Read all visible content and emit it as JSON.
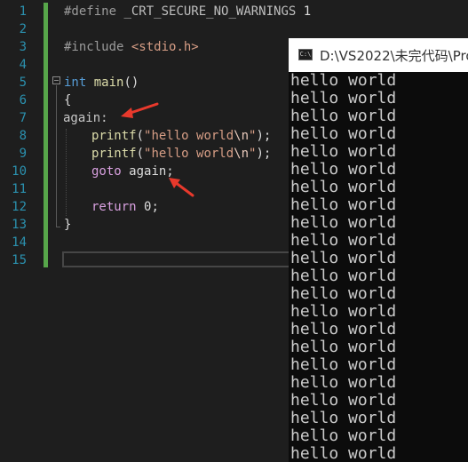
{
  "editor": {
    "line_numbers": [
      "1",
      "2",
      "3",
      "4",
      "5",
      "6",
      "7",
      "8",
      "9",
      "10",
      "11",
      "12",
      "13",
      "14",
      "15"
    ],
    "define_kw": "#define",
    "define_macro": "_CRT_SECURE_NO_WARNINGS",
    "define_value": "1",
    "include_kw": "#include",
    "include_file": "<stdio.h>",
    "int_kw": "int",
    "main_name": "main",
    "main_parens": "()",
    "open_brace": "{",
    "label_line": "again:",
    "printf_name": "printf",
    "printf_open": "(",
    "printf_str_open": "\"hello world",
    "printf_escape": "\\n",
    "printf_str_close": "\"",
    "printf_close": ");",
    "goto_kw": "goto",
    "goto_target": "again;",
    "return_kw": "return",
    "return_value": "0;",
    "close_brace": "}"
  },
  "console": {
    "title": "D:\\VS2022\\未完代码\\Pro",
    "icon_label": "C:\\",
    "output_lines": [
      "hello world",
      "hello world",
      "hello world",
      "hello world",
      "hello world",
      "hello world",
      "hello world",
      "hello world",
      "hello world",
      "hello world",
      "hello world",
      "hello world",
      "hello world",
      "hello world",
      "hello world",
      "hello world",
      "hello world",
      "hello world",
      "hello world",
      "hello world",
      "hello world",
      "hello world"
    ]
  },
  "colors": {
    "editor_bg": "#1e1e1e",
    "line_number": "#2b91af",
    "change_bar": "#57a64a",
    "keyword": "#569cd6",
    "function": "#dcdcaa",
    "string": "#d69d85",
    "macro": "#bd63c5",
    "annotation_arrow": "#e8392c",
    "console_bg": "#0c0c0c",
    "console_text": "#cccccc"
  }
}
